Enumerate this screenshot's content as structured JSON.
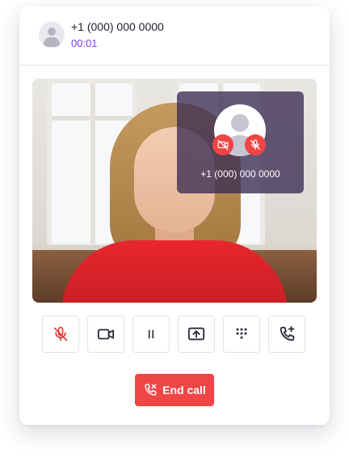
{
  "caller": {
    "number": "+1 (000) 000 0000",
    "duration": "00:01"
  },
  "pip": {
    "number": "+1 (000) 000 0000",
    "camera_status_icon": "video-off-icon",
    "mic_status_icon": "mic-off-icon"
  },
  "controls": [
    {
      "name": "mute-button",
      "icon": "mic-off-icon"
    },
    {
      "name": "video-button",
      "icon": "video-camera-icon"
    },
    {
      "name": "hold-button",
      "icon": "pause-icon"
    },
    {
      "name": "share-screen-button",
      "icon": "screen-share-icon"
    },
    {
      "name": "keypad-button",
      "icon": "dialpad-icon"
    },
    {
      "name": "add-call-button",
      "icon": "phone-plus-icon"
    }
  ],
  "end_call": {
    "label": "End call",
    "icon": "phone-x-icon"
  },
  "colors": {
    "accent": "#7b3fe4",
    "danger": "#f04545",
    "muted_icon": "#e53935"
  }
}
